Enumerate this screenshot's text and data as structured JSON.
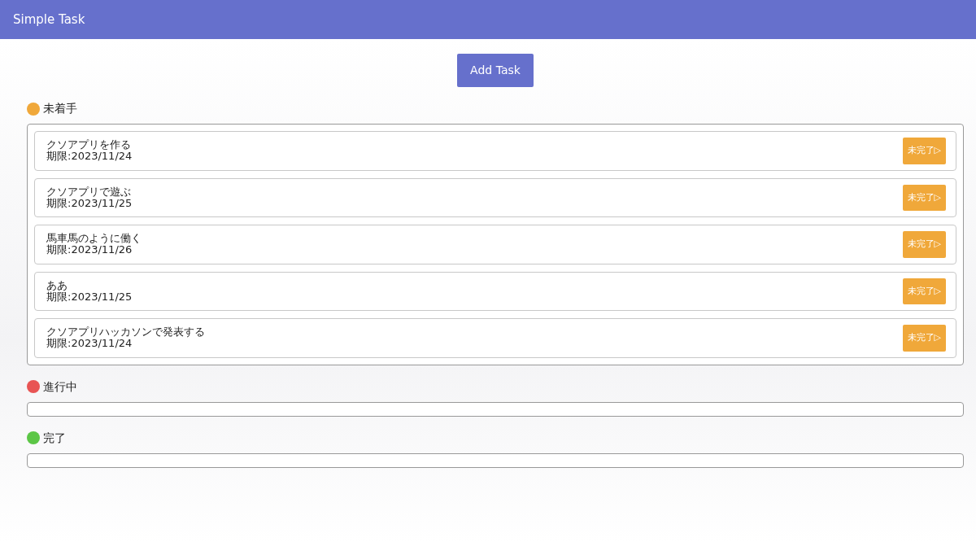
{
  "app_bar": {
    "title": "Simple Task"
  },
  "add_button": {
    "label": "Add Task"
  },
  "groups": [
    {
      "title": "未着手",
      "color": "#f0a83a",
      "tasks": [
        {
          "name": "クソアプリを作る",
          "due": "期限:2023/11/24",
          "action": "未完了▷"
        },
        {
          "name": "クソアプリで遊ぶ",
          "due": "期限:2023/11/25",
          "action": "未完了▷"
        },
        {
          "name": "馬車馬のように働く",
          "due": "期限:2023/11/26",
          "action": "未完了▷"
        },
        {
          "name": "ああ",
          "due": "期限:2023/11/25",
          "action": "未完了▷"
        },
        {
          "name": "クソアプリハッカソンで発表する",
          "due": "期限:2023/11/24",
          "action": "未完了▷"
        }
      ]
    },
    {
      "title": "進行中",
      "color": "#e85454"
    },
    {
      "title": "完了",
      "color": "#5cc646"
    }
  ]
}
